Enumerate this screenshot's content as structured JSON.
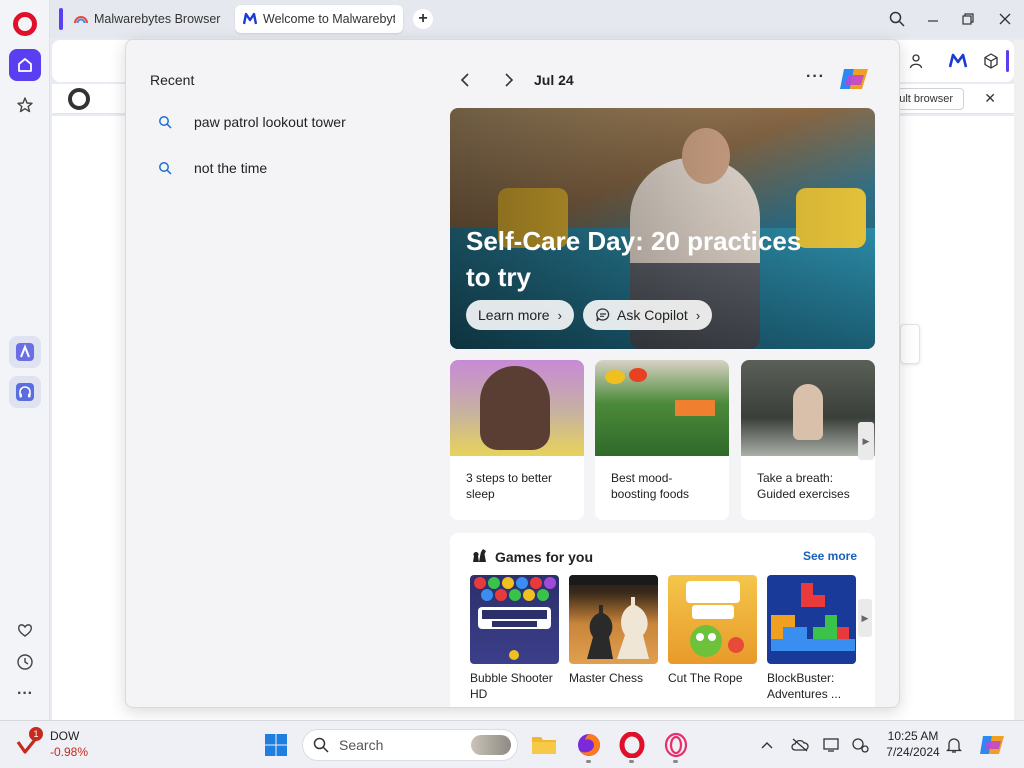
{
  "tabs": [
    {
      "label": "Malwarebytes Browser Gu"
    },
    {
      "label": "Welcome to Malwarebyte"
    }
  ],
  "banner": {
    "button_label": "ault browser"
  },
  "panel": {
    "recent_title": "Recent",
    "recent_items": [
      "paw patrol lookout tower",
      "not the time"
    ],
    "date": "Jul 24",
    "hero": {
      "title": "Self-Care Day: 20 practices to try",
      "learn_more": "Learn more",
      "ask_copilot": "Ask Copilot"
    },
    "cards": [
      {
        "label": "3 steps to better sleep"
      },
      {
        "label": "Best mood-boosting foods"
      },
      {
        "label": "Take a breath: Guided exercises"
      }
    ],
    "games": {
      "title": "Games for you",
      "see_more": "See more",
      "items": [
        {
          "label": "Bubble Shooter HD"
        },
        {
          "label": "Master Chess"
        },
        {
          "label": "Cut The Rope"
        },
        {
          "label": "BlockBuster: Adventures ..."
        }
      ]
    }
  },
  "taskbar": {
    "stock_name": "DOW",
    "stock_change": "-0.98%",
    "stock_badge": "1",
    "search_placeholder": "Search",
    "time": "10:25 AM",
    "date": "7/24/2024"
  },
  "colors": {
    "accent": "#5a3ef2",
    "opera_red": "#e0102a",
    "link_blue": "#1b5fbd",
    "negative": "#c42b1c"
  }
}
